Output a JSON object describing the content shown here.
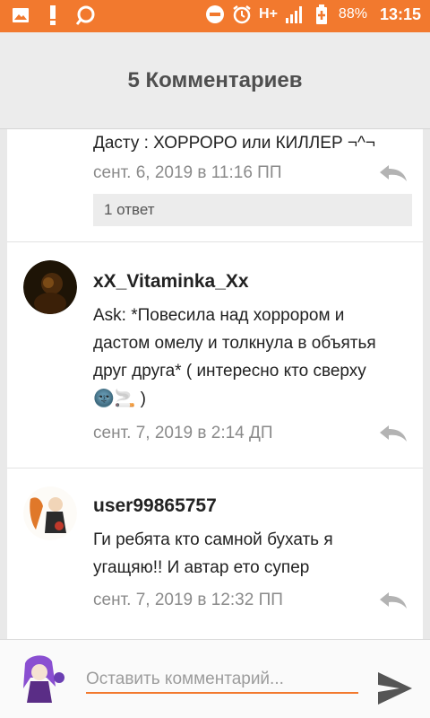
{
  "statusbar": {
    "network": "H+",
    "battery_percent": "88%",
    "time": "13:15",
    "icons": [
      "gallery-icon",
      "alert-icon",
      "app-icon",
      "dnd-icon",
      "alarm-icon",
      "network-type-icon",
      "signal-icon",
      "battery-icon"
    ]
  },
  "header": {
    "title": "5 Комментариев"
  },
  "comments": [
    {
      "text": "Дасту : ХОРРОРО или КИЛЛЕР ¬^¬",
      "date": "сент. 6, 2019 в 11:16 ПП",
      "replies": "1 ответ"
    },
    {
      "author": "xX_Vitaminka_Xx",
      "text": "Ask: *Повесила над хоррором и дастом омелу и толкнула в объятья друг друга* ( интересно кто сверху 🌚🚬 )",
      "date": "сент. 7, 2019 в 2:14 ДП"
    },
    {
      "author": "user99865757",
      "text": "Ги ребята кто самной бухать я угащяю!! И автар ето супер",
      "date": "сент. 7, 2019 в 12:32 ПП"
    }
  ],
  "composer": {
    "placeholder": "Оставить комментарий..."
  },
  "colors": {
    "accent": "#f2792e",
    "header_bg": "#ececec",
    "date_text": "#8a8a8a"
  }
}
